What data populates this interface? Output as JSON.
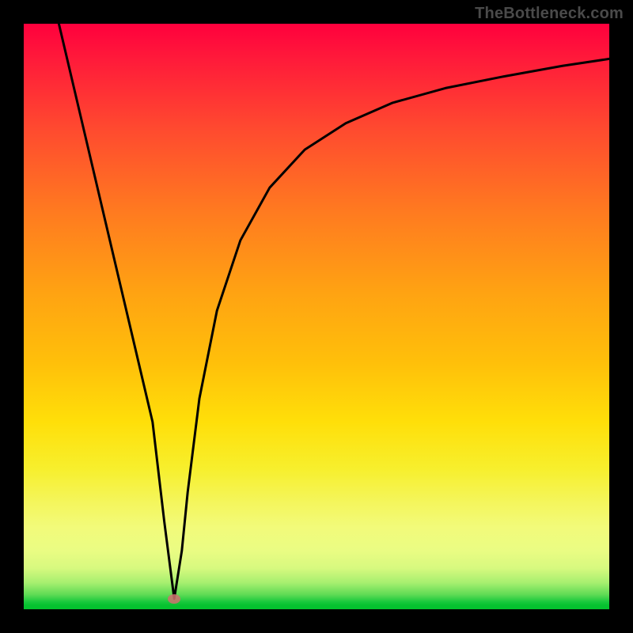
{
  "watermark": "TheBottleneck.com",
  "marker": {
    "x_pct": 25.7,
    "y_pct": 98.3
  },
  "chart_data": {
    "type": "line",
    "title": "",
    "xlabel": "",
    "ylabel": "",
    "xlim": [
      0,
      100
    ],
    "ylim": [
      0,
      100
    ],
    "grid": false,
    "legend": false,
    "series": [
      {
        "name": "bottleneck-curve",
        "x": [
          6.0,
          10.0,
          14.0,
          18.0,
          22.0,
          24.0,
          25.7,
          27.0,
          28.0,
          30.0,
          33.0,
          37.0,
          42.0,
          48.0,
          55.0,
          63.0,
          72.0,
          82.0,
          92.0,
          100.0
        ],
        "y": [
          100.0,
          83.0,
          66.0,
          49.0,
          32.0,
          15.0,
          1.8,
          10.0,
          20.0,
          36.0,
          51.0,
          63.0,
          72.0,
          78.5,
          83.0,
          86.5,
          89.0,
          91.0,
          92.8,
          94.0
        ]
      }
    ],
    "marker_point": {
      "x": 25.7,
      "y": 1.8
    },
    "background_gradient": {
      "direction": "vertical",
      "stops": [
        {
          "pct": 0,
          "color": "#ff003d"
        },
        {
          "pct": 6,
          "color": "#ff1a3a"
        },
        {
          "pct": 18,
          "color": "#ff4a2f"
        },
        {
          "pct": 32,
          "color": "#ff7a20"
        },
        {
          "pct": 46,
          "color": "#ffa312"
        },
        {
          "pct": 58,
          "color": "#ffc00a"
        },
        {
          "pct": 68,
          "color": "#ffdf09"
        },
        {
          "pct": 76,
          "color": "#f7ef2d"
        },
        {
          "pct": 82,
          "color": "#f4f65e"
        },
        {
          "pct": 86,
          "color": "#f2fb7a"
        },
        {
          "pct": 90,
          "color": "#eafc83"
        },
        {
          "pct": 93,
          "color": "#d7f97f"
        },
        {
          "pct": 95.5,
          "color": "#a6ef6f"
        },
        {
          "pct": 97.5,
          "color": "#5fdb55"
        },
        {
          "pct": 98.7,
          "color": "#1ac93d"
        },
        {
          "pct": 99.3,
          "color": "#07c330"
        },
        {
          "pct": 100,
          "color": "#03c12e"
        }
      ]
    }
  }
}
